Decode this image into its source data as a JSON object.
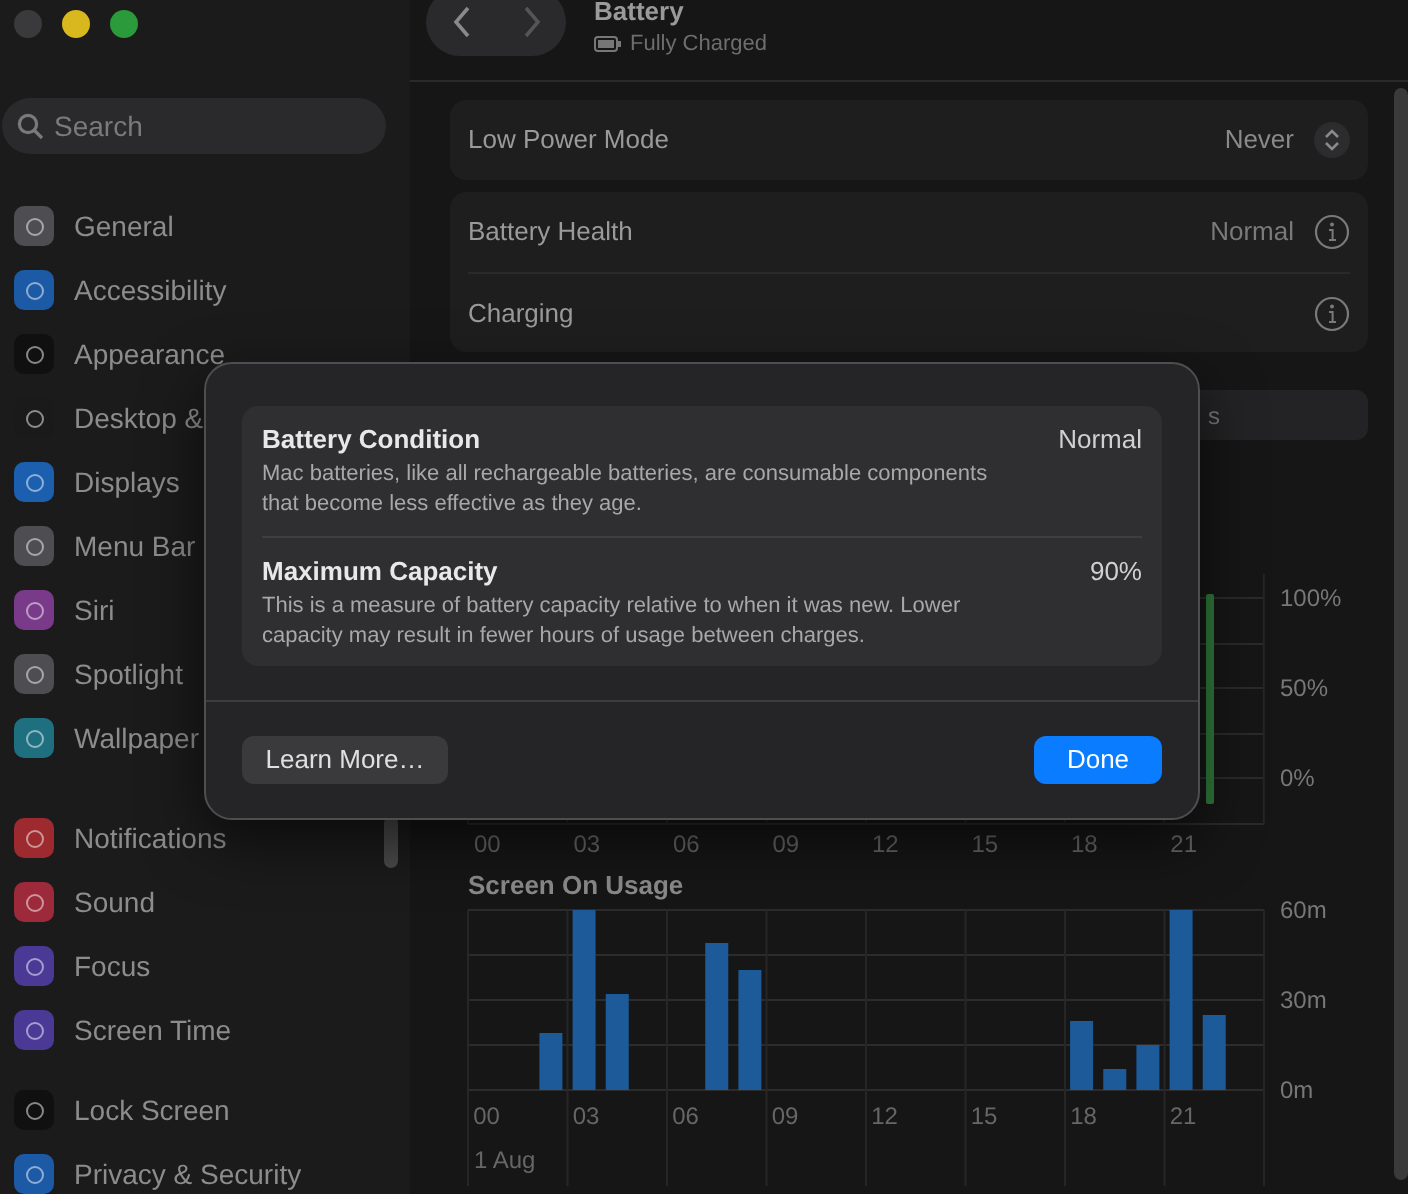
{
  "sidebar": {
    "search": {
      "placeholder": "Search"
    },
    "groups": [
      [
        {
          "label": "General",
          "color": "#4e4e52"
        },
        {
          "label": "Accessibility",
          "color": "#1d5aa6"
        },
        {
          "label": "Appearance",
          "color": "#101010"
        },
        {
          "label": "Desktop &",
          "color": "#1a1a1a"
        },
        {
          "label": "Displays",
          "color": "#1c5fae"
        },
        {
          "label": "Menu Bar",
          "color": "#4e4e52"
        },
        {
          "label": "Siri",
          "color": "#7a3a8a"
        },
        {
          "label": "Spotlight",
          "color": "#4e4e52"
        },
        {
          "label": "Wallpaper",
          "color": "#1e6f80"
        }
      ],
      [
        {
          "label": "Notifications",
          "color": "#9c2a2e"
        },
        {
          "label": "Sound",
          "color": "#9c2a3a"
        },
        {
          "label": "Focus",
          "color": "#4a3a96"
        },
        {
          "label": "Screen Time",
          "color": "#4a3a96"
        }
      ],
      [
        {
          "label": "Lock Screen",
          "color": "#101010"
        },
        {
          "label": "Privacy & Security",
          "color": "#1d5aa6"
        }
      ]
    ]
  },
  "header": {
    "title": "Battery",
    "subtitle": "Fully Charged"
  },
  "setting_groups": [
    [
      {
        "kind": "select",
        "label": "Low Power Mode",
        "value": "Never"
      }
    ],
    [
      {
        "kind": "info",
        "label": "Battery Health",
        "value": "Normal"
      },
      {
        "kind": "info",
        "label": "Charging"
      }
    ]
  ],
  "range_control": {
    "visible_text": "s"
  },
  "battery_level_chart": {
    "y_labels": [
      "100%",
      "50%",
      "0%"
    ],
    "x_labels": [
      "00",
      "03",
      "06",
      "09",
      "12",
      "15",
      "18",
      "21"
    ]
  },
  "usage_chart": {
    "title": "Screen On Usage",
    "date_label": "1 Aug",
    "chart_data": {
      "type": "bar",
      "xlim": [
        -0.5,
        23.5
      ],
      "x": [
        0,
        1,
        2,
        3,
        4,
        5,
        6,
        7,
        8,
        9,
        10,
        11,
        12,
        13,
        14,
        15,
        16,
        17,
        18,
        19,
        20,
        21,
        22,
        23
      ],
      "values": [
        0,
        0,
        19,
        60,
        32,
        0,
        0,
        49,
        40,
        0,
        0,
        0,
        0,
        0,
        0,
        0,
        0,
        0,
        23,
        7,
        15,
        60,
        25,
        0
      ],
      "xticks": [
        {
          "value": 0,
          "label": "00"
        },
        {
          "value": 3,
          "label": "03"
        },
        {
          "value": 6,
          "label": "06"
        },
        {
          "value": 9,
          "label": "09"
        },
        {
          "value": 12,
          "label": "12"
        },
        {
          "value": 15,
          "label": "15"
        },
        {
          "value": 18,
          "label": "18"
        },
        {
          "value": 21,
          "label": "21"
        }
      ],
      "ylim": [
        0,
        60
      ],
      "yticks": [
        {
          "value": 0,
          "label": "0m"
        },
        {
          "value": 30,
          "label": "30m"
        },
        {
          "value": 60,
          "label": "60m"
        }
      ]
    }
  },
  "sheet": {
    "rows": [
      {
        "title": "Battery Condition",
        "value": "Normal",
        "description": "Mac batteries, like all rechargeable batteries, are consumable components that become less effective as they age."
      },
      {
        "title": "Maximum Capacity",
        "value": "90%",
        "description": "This is a measure of battery capacity relative to when it was new. Lower capacity may result in fewer hours of usage between charges."
      }
    ],
    "buttons": [
      {
        "kind": "secondary",
        "label": "Learn More…"
      },
      {
        "kind": "primary",
        "label": "Done"
      }
    ]
  }
}
